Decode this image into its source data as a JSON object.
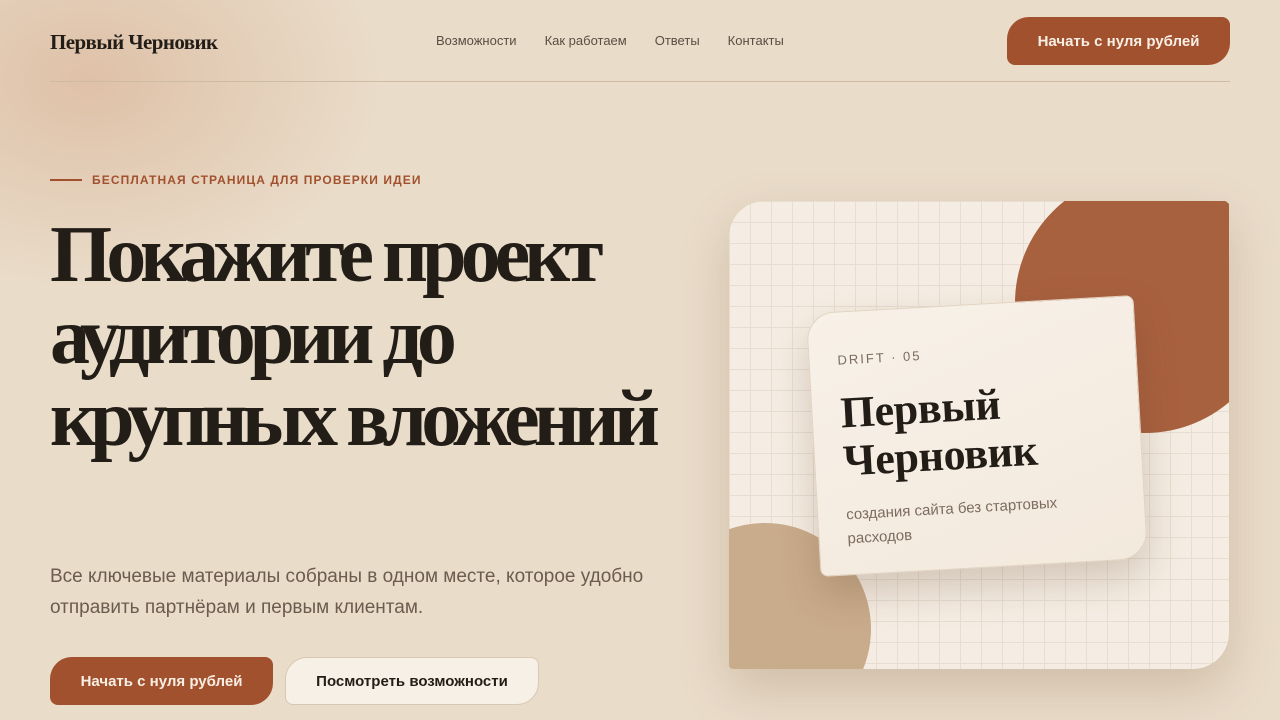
{
  "header": {
    "logo": "Первый Черновик",
    "nav": [
      "Возможности",
      "Как работаем",
      "Ответы",
      "Контакты"
    ],
    "cta": "Начать с нуля рублей"
  },
  "hero": {
    "eyebrow": "БЕСПЛАТНАЯ СТРАНИЦА ДЛЯ ПРОВЕРКИ ИДЕИ",
    "headline": "Покажите проект аудитории до крупных вложений",
    "lead": "Все ключевые материалы собраны в одном месте, которое удобно отправить партнёрам и первым клиентам.",
    "primary_button": "Начать с нуля рублей",
    "secondary_button": "Посмотреть возможности"
  },
  "card": {
    "tag": "DRIFT · 05",
    "title": "Первый Черновик",
    "subtitle": "создания сайта без стартовых расходов"
  },
  "colors": {
    "accent": "#a2512f",
    "background": "#e9dcc9",
    "text": "#231d18"
  }
}
